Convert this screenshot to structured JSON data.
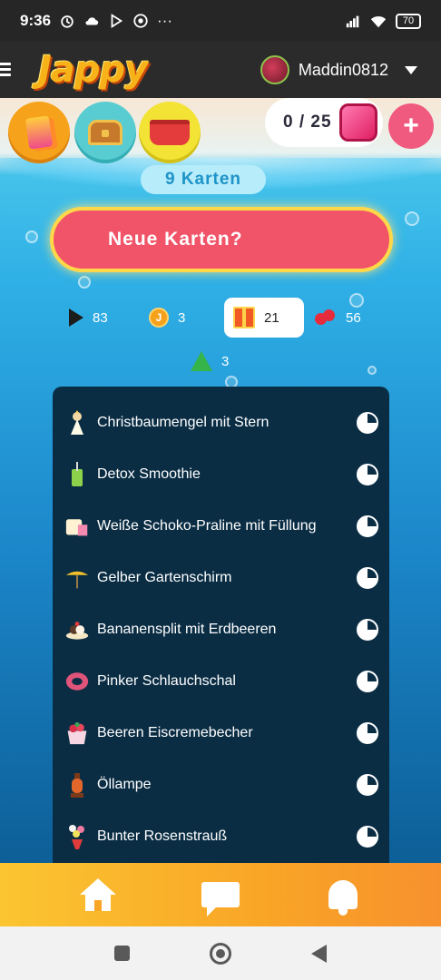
{
  "status_bar": {
    "time": "9:36",
    "more": "···",
    "battery": "70",
    "icons": [
      "alarm-icon",
      "cloud-icon",
      "play-store-icon",
      "chrome-icon",
      "signal-icon",
      "wifi-icon",
      "battery-icon"
    ]
  },
  "header": {
    "logo": "Jappy",
    "username": "Maddin0812"
  },
  "top_bar": {
    "counter": "0 / 25",
    "plus": "+"
  },
  "game": {
    "cards_count": "9 Karten",
    "new_cards_button": "Neue Karten?"
  },
  "stats": [
    {
      "icon": "play-icon",
      "value": "83"
    },
    {
      "icon": "coin-icon",
      "value": "3"
    },
    {
      "icon": "gift-icon",
      "value": "21"
    },
    {
      "icon": "berries-icon",
      "value": "56"
    },
    {
      "icon": "tree-icon",
      "value": "3"
    }
  ],
  "cards": [
    {
      "label": "Christbaumengel mit Stern",
      "icon": "angel-icon"
    },
    {
      "label": "Detox Smoothie",
      "icon": "smoothie-icon"
    },
    {
      "label": "Weiße Schoko-Praline mit Füllung",
      "icon": "praline-icon"
    },
    {
      "label": "Gelber Gartenschirm",
      "icon": "umbrella-icon"
    },
    {
      "label": "Bananensplit mit Erdbeeren",
      "icon": "banana-split-icon"
    },
    {
      "label": "Pinker Schlauchschal",
      "icon": "scarf-icon"
    },
    {
      "label": "Beeren Eiscremebecher",
      "icon": "ice-cream-icon"
    },
    {
      "label": "Öllampe",
      "icon": "oil-lamp-icon"
    },
    {
      "label": "Bunter Rosenstrauß",
      "icon": "bouquet-icon"
    }
  ],
  "bottom_nav": [
    "home-icon",
    "chat-icon",
    "bell-icon"
  ],
  "colors": {
    "accent_red": "#f15468",
    "accent_yellow": "#ffd84a",
    "nav_orange": "#f9a526",
    "list_bg": "#0a2d44"
  }
}
